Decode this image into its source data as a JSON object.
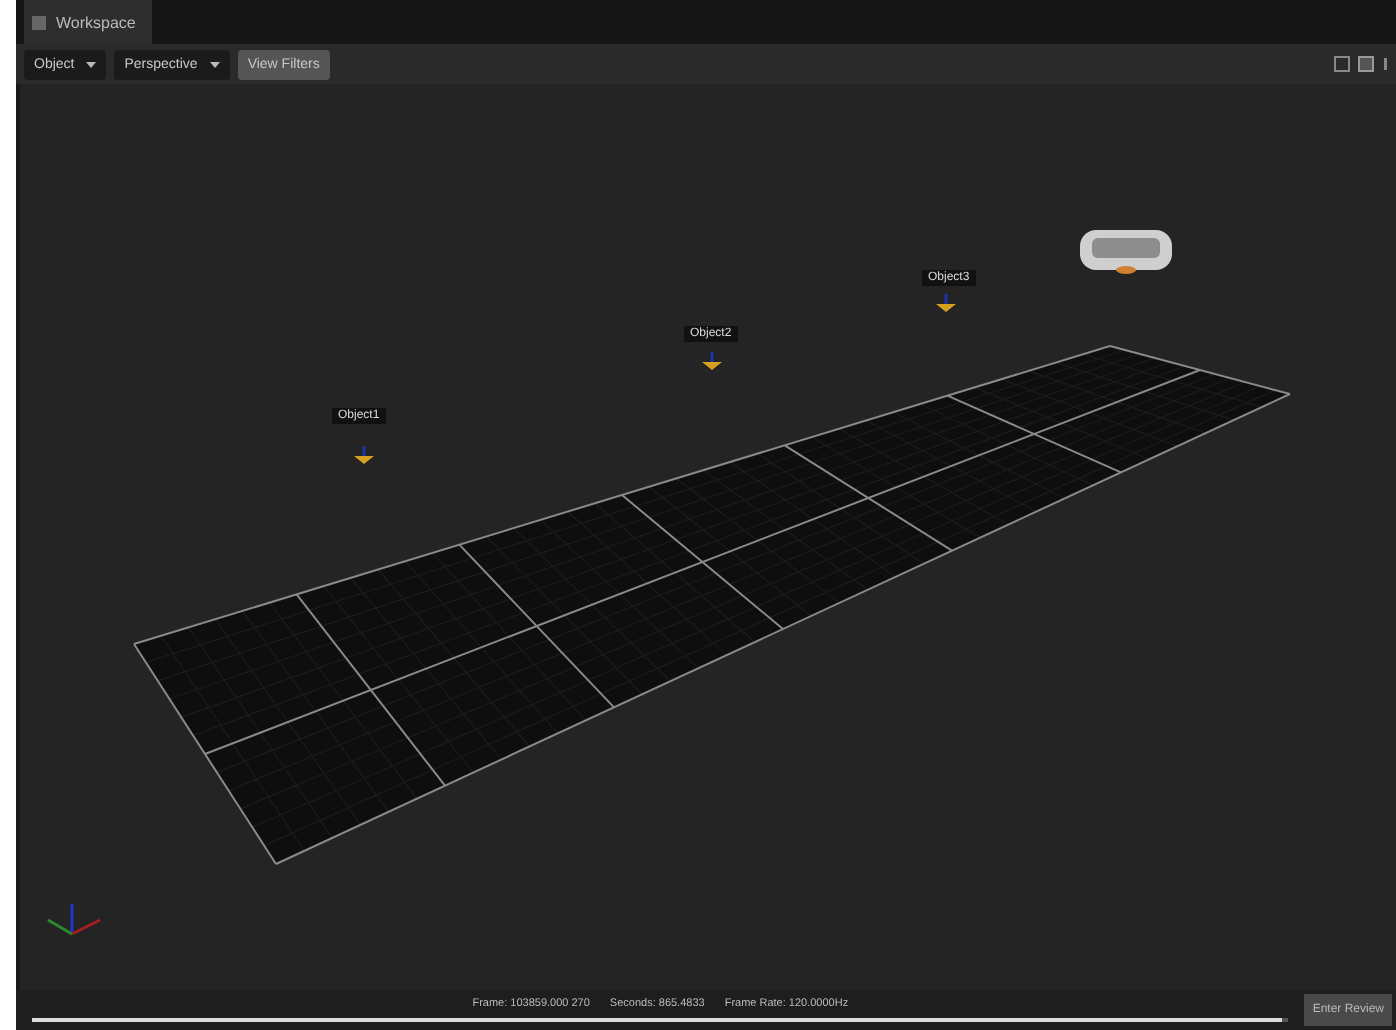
{
  "window": {
    "title": "Workspace"
  },
  "toolbar": {
    "object_menu": "Object",
    "view_menu": "Perspective",
    "filters_button": "View Filters"
  },
  "objects": [
    {
      "label": "Object1"
    },
    {
      "label": "Object2"
    },
    {
      "label": "Object3"
    }
  ],
  "status": {
    "frame": "Frame: 103859.000 270",
    "seconds": "Seconds: 865.4833",
    "frame_rate": "Frame Rate: 120.0000Hz",
    "level": 0.995
  },
  "review_button": "Enter Review"
}
